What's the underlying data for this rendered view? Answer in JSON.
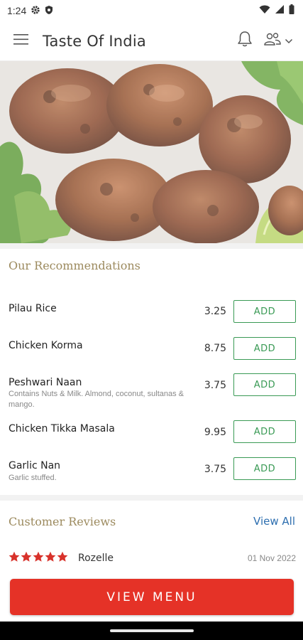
{
  "status_bar": {
    "time": "1:24",
    "icons": [
      "gear-icon",
      "shield-icon",
      "wifi-icon",
      "signal-icon",
      "battery-icon"
    ]
  },
  "app_bar": {
    "title": "Taste Of India",
    "icons": [
      "hamburger-menu-icon",
      "bell-icon",
      "account-group-icon",
      "chevron-down-icon"
    ]
  },
  "hero": {
    "image": "grilled-chicken-tikka-platter"
  },
  "recommendations": {
    "title": "Our Recommendations",
    "add_label": "ADD",
    "items": [
      {
        "name": "Pilau Rice",
        "description": "",
        "price": "3.25"
      },
      {
        "name": "Chicken Korma",
        "description": "",
        "price": "8.75"
      },
      {
        "name": "Peshwari Naan",
        "description": "Contains Nuts & Milk. Almond, coconut, sultanas & mango.",
        "price": "3.75"
      },
      {
        "name": "Chicken Tikka Masala",
        "description": "",
        "price": "9.95"
      },
      {
        "name": "Garlic Nan",
        "description": "Garlic stuffed.",
        "price": "3.75"
      }
    ]
  },
  "reviews": {
    "title": "Customer Reviews",
    "view_all_label": "View All",
    "items": [
      {
        "rating": 5,
        "reviewer": "Rozelle",
        "date": "01 Nov 2022"
      }
    ]
  },
  "cta": {
    "label": "VIEW MENU"
  },
  "colors": {
    "accent_red": "#e53227",
    "add_green": "#3a9a55",
    "section_gold": "#9c8a5e",
    "link_blue": "#2e6fb0",
    "star_red": "#d8322b"
  }
}
